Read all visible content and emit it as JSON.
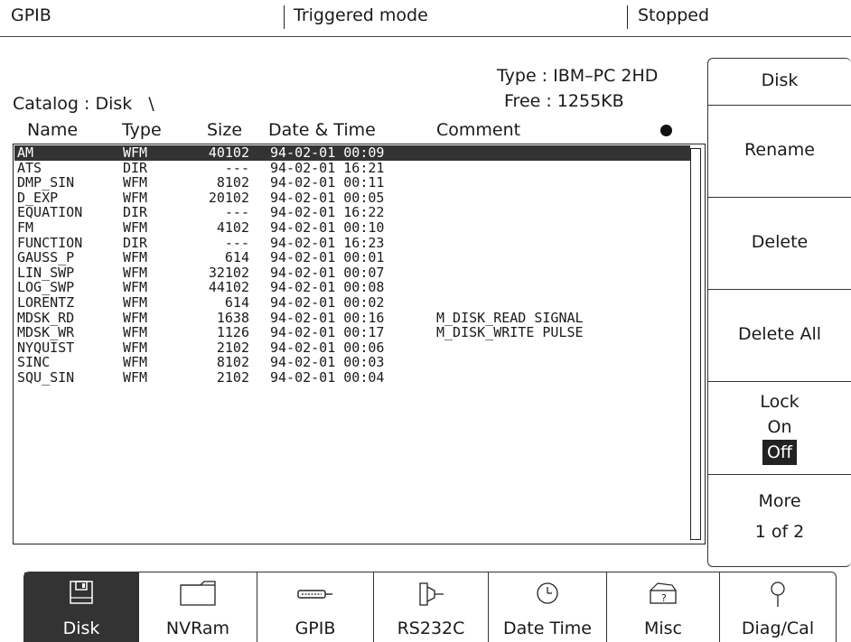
{
  "status": {
    "left": "GPIB",
    "center": "Triggered mode",
    "right": "Stopped"
  },
  "catalog": {
    "label": "Catalog : Disk   \\",
    "type_line": "Type : IBM–PC 2HD",
    "free_line": "Free : 1255KB",
    "columns": {
      "name": "Name",
      "type": "Type",
      "size": "Size",
      "datetime": "Date & Time",
      "comment": "Comment"
    },
    "files": [
      {
        "name": "AM",
        "type": "WFM",
        "size": "40102",
        "datetime": "94-02-01 00:09",
        "comment": "",
        "selected": true
      },
      {
        "name": "ATS",
        "type": "DIR",
        "size": "---",
        "datetime": "94-02-01 16:21",
        "comment": ""
      },
      {
        "name": "DMP_SIN",
        "type": "WFM",
        "size": "8102",
        "datetime": "94-02-01 00:11",
        "comment": ""
      },
      {
        "name": "D_EXP",
        "type": "WFM",
        "size": "20102",
        "datetime": "94-02-01 00:05",
        "comment": ""
      },
      {
        "name": "EQUATION",
        "type": "DIR",
        "size": "---",
        "datetime": "94-02-01 16:22",
        "comment": ""
      },
      {
        "name": "FM",
        "type": "WFM",
        "size": "4102",
        "datetime": "94-02-01 00:10",
        "comment": ""
      },
      {
        "name": "FUNCTION",
        "type": "DIR",
        "size": "---",
        "datetime": "94-02-01 16:23",
        "comment": ""
      },
      {
        "name": "GAUSS_P",
        "type": "WFM",
        "size": "614",
        "datetime": "94-02-01 00:01",
        "comment": ""
      },
      {
        "name": "LIN_SWP",
        "type": "WFM",
        "size": "32102",
        "datetime": "94-02-01 00:07",
        "comment": ""
      },
      {
        "name": "LOG_SWP",
        "type": "WFM",
        "size": "44102",
        "datetime": "94-02-01 00:08",
        "comment": ""
      },
      {
        "name": "LORENTZ",
        "type": "WFM",
        "size": "614",
        "datetime": "94-02-01 00:02",
        "comment": ""
      },
      {
        "name": "MDSK_RD",
        "type": "WFM",
        "size": "1638",
        "datetime": "94-02-01 00:16",
        "comment": "M_DISK_READ SIGNAL"
      },
      {
        "name": "MDSK_WR",
        "type": "WFM",
        "size": "1126",
        "datetime": "94-02-01 00:17",
        "comment": "M_DISK_WRITE PULSE"
      },
      {
        "name": "NYQUIST",
        "type": "WFM",
        "size": "2102",
        "datetime": "94-02-01 00:06",
        "comment": ""
      },
      {
        "name": "SINC",
        "type": "WFM",
        "size": "8102",
        "datetime": "94-02-01 00:03",
        "comment": ""
      },
      {
        "name": "SQU_SIN",
        "type": "WFM",
        "size": "2102",
        "datetime": "94-02-01 00:04",
        "comment": ""
      }
    ]
  },
  "softkeys": {
    "title": "Disk",
    "rename": "Rename",
    "delete": "Delete",
    "delete_all": "Delete All",
    "lock": {
      "label": "Lock",
      "on": "On",
      "off": "Off",
      "state": "Off"
    },
    "more": {
      "label": "More",
      "page": "1 of 2"
    }
  },
  "tabs": [
    {
      "label": "Disk",
      "icon": "floppy-disk-icon",
      "active": true
    },
    {
      "label": "NVRam",
      "icon": "folder-icon"
    },
    {
      "label": "GPIB",
      "icon": "gpib-connector-icon"
    },
    {
      "label": "RS232C",
      "icon": "serial-connector-icon"
    },
    {
      "label": "Date Time",
      "icon": "clock-icon"
    },
    {
      "label": "Misc",
      "icon": "toolbox-icon"
    },
    {
      "label": "Diag/Cal",
      "icon": "probe-icon"
    }
  ]
}
